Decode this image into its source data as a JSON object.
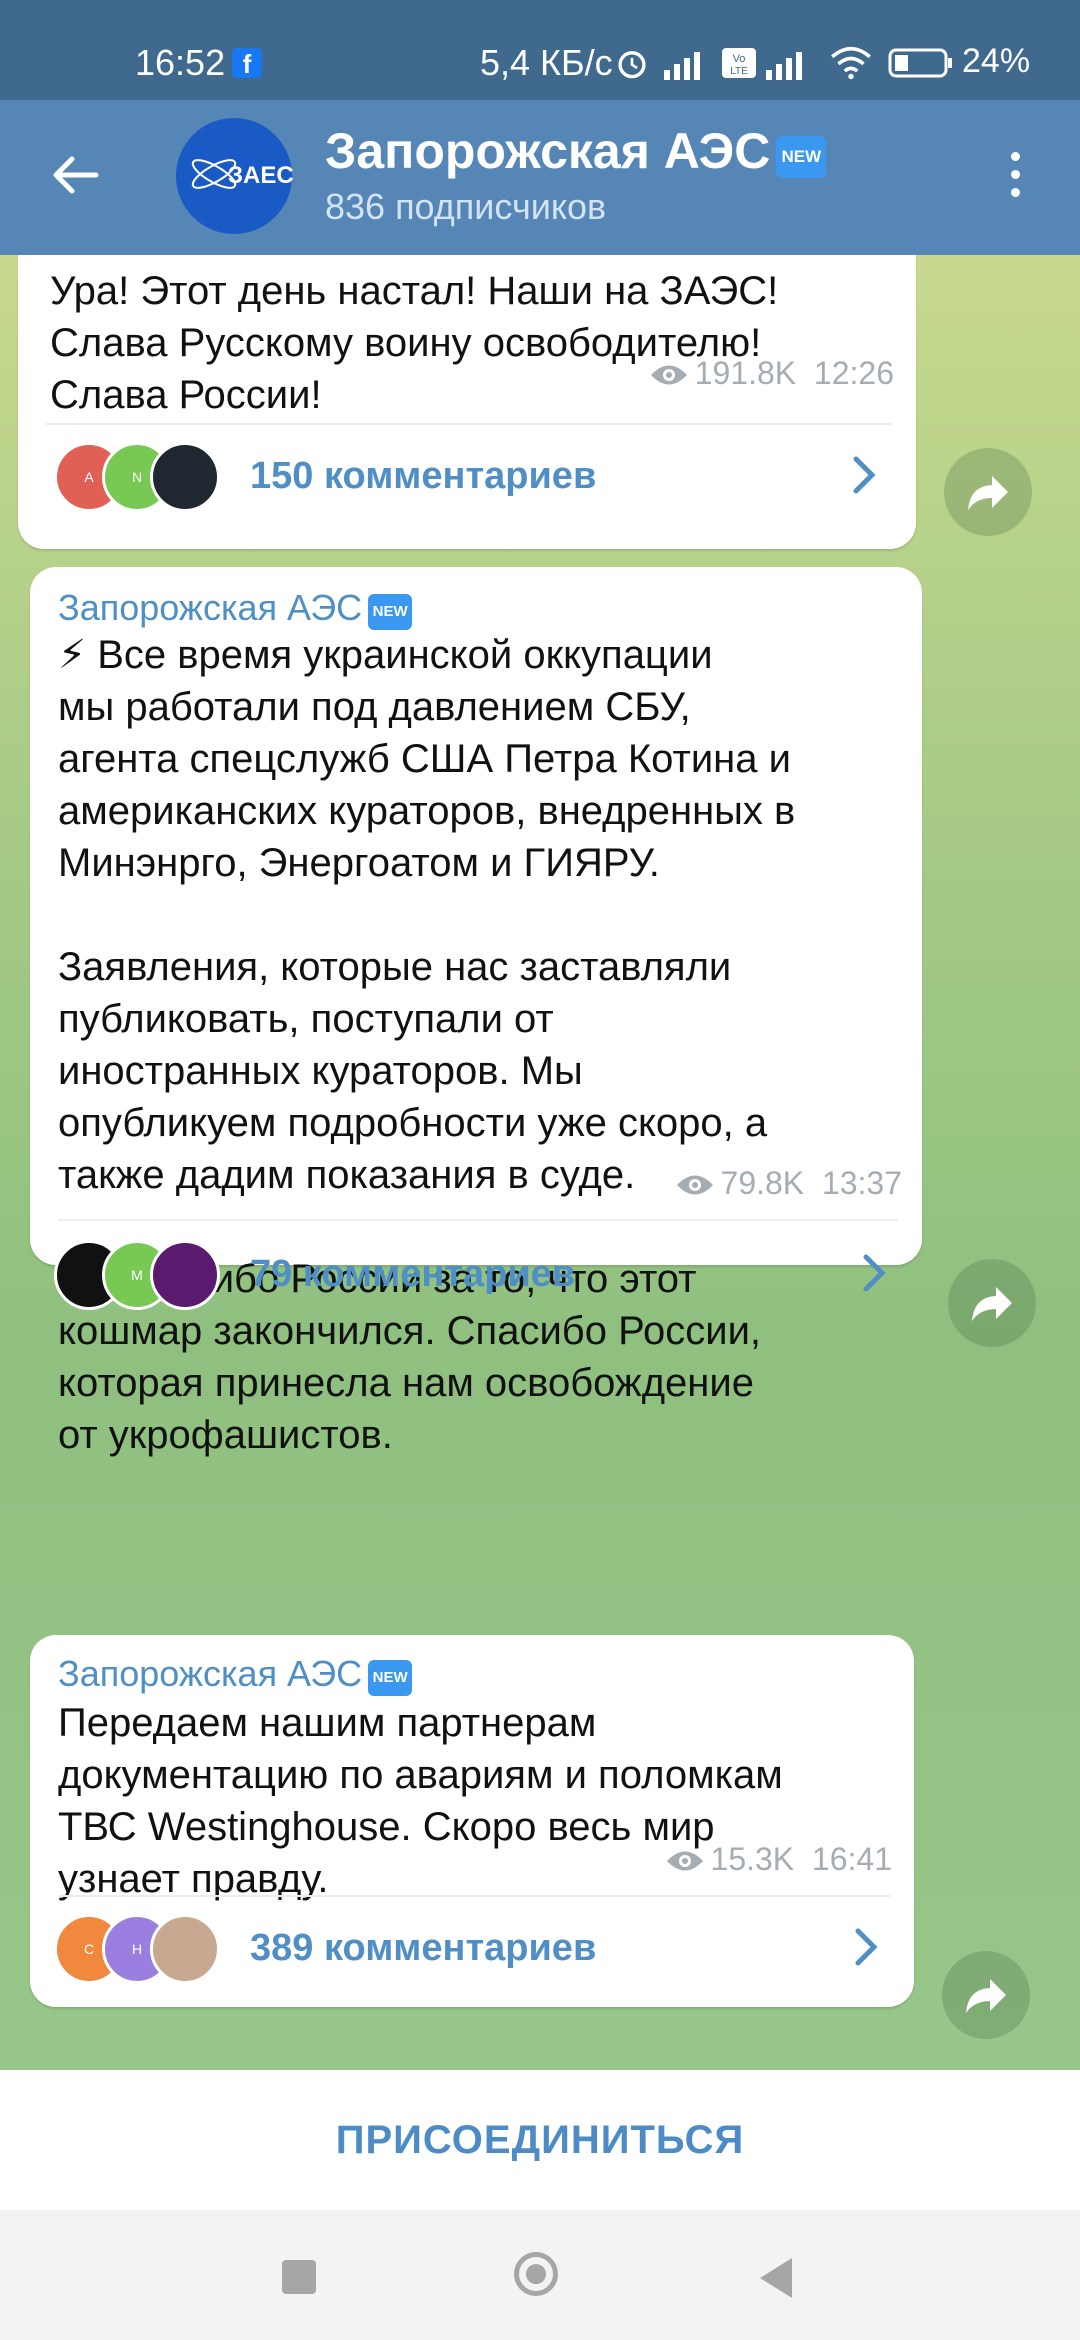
{
  "status_bar": {
    "time": "16:52",
    "fb_badge": "f",
    "net_speed": "5,4 КБ/с",
    "battery": "24%"
  },
  "header": {
    "title": "Запорожская АЭС",
    "badge": "NEW",
    "subtitle": "836 подписчиков",
    "avatar_text": "ЗАЕС"
  },
  "messages": [
    {
      "text": "Ура! Этот день настал! Наши на ЗАЭС!\nСлава Русскому воину освободителю!\nСлава России!",
      "views": "191.8K",
      "time": "12:26",
      "comments": "150 комментариев",
      "avatars": [
        "A",
        "N",
        ""
      ]
    },
    {
      "author": "Запорожская АЭС",
      "badge": "NEW",
      "text": "⚡ Все время украинской оккупации\nмы работали под давлением СБУ,\nагента спецслужб США Петра Котина и\nамериканских кураторов, внедренных в\nМинэнрго, Энергоатом и ГИЯРУ.\n\nЗаявления, которые нас заставляли\nпубликовать, поступали от\nиностранных кураторов. Мы\nопубликуем подробности уже скоро, а\nтакже дадим показания в суде.\n\n🇷🇺 Спасибо России за то, что этот\nкошмар закончился. Спасибо России,\nкоторая принесла нам освобождение\nот укрофашистов.",
      "views": "79.8K",
      "time": "13:37",
      "comments": "79 комментариев",
      "avatars": [
        "",
        "M",
        ""
      ]
    },
    {
      "author": "Запорожская АЭС",
      "badge": "NEW",
      "text": "Передаем нашим партнерам\nдокументацию по авариям и поломкам\nТВС Westinghouse. Скоро весь мир\nузнает правду.",
      "views": "15.3K",
      "time": "16:41",
      "comments": "389 комментариев",
      "avatars": [
        "C",
        "H",
        ""
      ]
    }
  ],
  "join_button": "ПРИСОЕДИНИТЬСЯ",
  "colors": {
    "header": "#5586b6",
    "statusbar": "#3f6a8e",
    "accent": "#4f8fc6"
  }
}
